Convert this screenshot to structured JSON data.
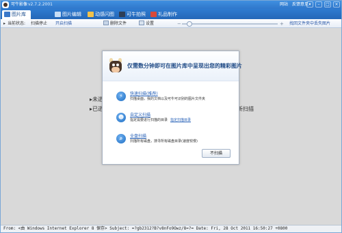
{
  "window": {
    "title": "可牛影像",
    "version": "v2.7.2.2001",
    "links": [
      "网站",
      "反馈意见"
    ],
    "controls": [
      "▾",
      "–",
      "□",
      "×"
    ]
  },
  "tabs": [
    {
      "label": "图片库",
      "active": true,
      "icon_color": "#3a78c9"
    },
    {
      "label": "图片编辑",
      "active": false,
      "icon_color": "#c7ddf5"
    },
    {
      "label": "动感闪图",
      "active": false,
      "icon_color": "#f2c14a"
    },
    {
      "label": "可牛拍照",
      "active": false,
      "icon_color": "#2d3e57"
    },
    {
      "label": "礼品制作",
      "active": false,
      "icon_color": "#d94a3a"
    }
  ],
  "toolbar": {
    "status_prefix": "当前状态:",
    "status_value": "扫描停止",
    "start_scan": "开启扫描",
    "delete_file": "删除文件",
    "settings": "设置",
    "slider_minus": "−",
    "slider_plus": "+",
    "zoom_fraction": 0.08,
    "right_link": "找回文件夹中丢失图片"
  },
  "background": {
    "line1_left": "▸未逝",
    "line2_left": "▸已逝",
    "line2_right": "新扫描"
  },
  "dialog": {
    "title": "仅需数分钟即可在图片库中呈现出您的精彩图片",
    "options": [
      {
        "icon": "lightning-icon",
        "glyph": "⚡",
        "link": "快速扫描(推荐)",
        "desc": "扫描桌面，我的文档以及可牛可识别的图片文件夹",
        "extra": ""
      },
      {
        "icon": "user-icon",
        "glyph": "☻",
        "link": "自定义扫描",
        "desc": "指定需要进行扫描的目录",
        "extra": "指定扫描目录"
      },
      {
        "icon": "magnifier-icon",
        "glyph": "⌕",
        "link": "全盘扫描",
        "desc": "扫描所有磁盘，搜寻所有磁盘目录(速度较慢)",
        "extra": ""
      }
    ],
    "skip_label": "不扫描"
  },
  "statusbar": {
    "text": "From: <由 Windows Internet Explorer 8 保存> Subject: =?gb2312?B?v8nFo9Owz/8=?= Date: Fri, 28 Oct 2011 16:50:27 +0800"
  }
}
